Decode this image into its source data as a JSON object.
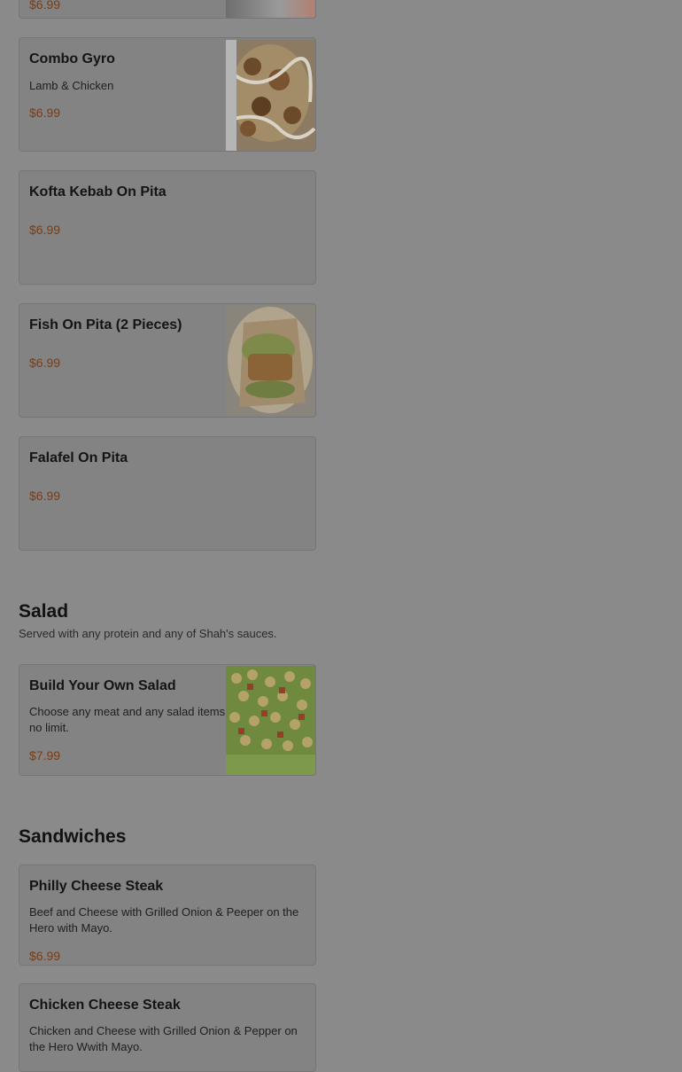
{
  "top_item": {
    "price": "$6.99"
  },
  "pita_items": [
    {
      "name": "Combo Gyro",
      "description": "Lamb & Chicken",
      "price": "$6.99"
    },
    {
      "name": "Kofta Kebab On Pita",
      "price": "$6.99"
    },
    {
      "name": "Fish On Pita (2 Pieces)",
      "price": "$6.99"
    },
    {
      "name": "Falafel On Pita",
      "price": "$6.99"
    }
  ],
  "salad": {
    "title": "Salad",
    "subtitle": "Served with any protein and any of Shah's sauces.",
    "items": [
      {
        "name": "Build Your Own Salad",
        "description": "Choose any meat and any salad items no limit.",
        "price": "$7.99"
      }
    ]
  },
  "sandwiches": {
    "title": "Sandwiches",
    "items": [
      {
        "name": "Philly Cheese Steak",
        "description": "Beef and Cheese with Grilled Onion & Peeper on  the Hero with Mayo.",
        "price": "$6.99"
      },
      {
        "name": "Chicken Cheese Steak",
        "description": "Chicken and Cheese with Grilled Onion & Pepper on the Hero Wwith Mayo."
      }
    ]
  },
  "colors": {
    "overlay": "#8a8a8a",
    "price": "#7a3c15",
    "card": "#838383"
  },
  "icons": [
    "gyro-photo",
    "fish-pita-photo",
    "salad-photo"
  ]
}
